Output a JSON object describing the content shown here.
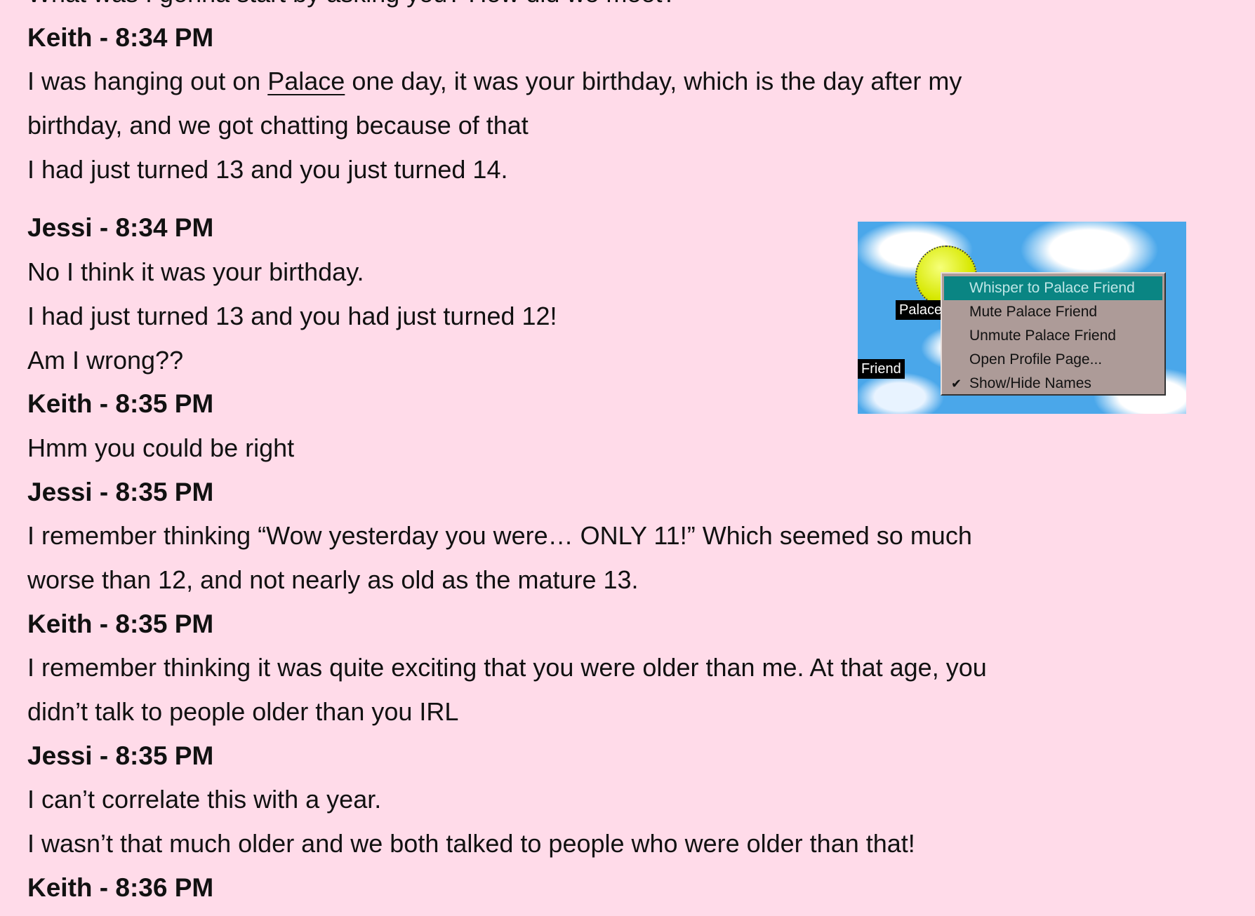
{
  "messages": [
    {
      "type": "text",
      "lines": [
        "What was I gonna start by asking you? How did we meet?"
      ]
    },
    {
      "type": "header",
      "text": "Keith - 8:34 PM"
    },
    {
      "type": "text",
      "lines": [
        "I was hanging out on ",
        "PALACE_LINK",
        " one day, it was your birthday, which is the day after my"
      ]
    }
  ],
  "link_text": "Palace",
  "line1_pre": "I was hanging out on ",
  "line1_post": " one day, it was your birthday, which is the day after my",
  "lines": [
    "What was I gonna start by asking you? How did we meet?",
    "Keith - 8:34 PM",
    "",
    "birthday, and we got chatting because of that",
    "I had just turned 13 and you just turned 14.",
    "Jessi - 8:34 PM",
    "No I think it was your birthday.",
    "I had just turned 13 and you had just turned 12!",
    "Am I wrong??",
    "Keith - 8:35 PM",
    "Hmm you could be right",
    "Jessi - 8:35 PM",
    "I remember thinking “Wow yesterday you were… ONLY 11!” Which seemed so much",
    "worse than 12, and not nearly as old as the mature 13.",
    "Keith - 8:35 PM",
    "I remember thinking it was quite exciting that you were older than me. At that age, you",
    "didn’t talk to people older than you IRL",
    "Jessi - 8:35 PM",
    "I can’t correlate this with a year.",
    "I wasn’t that much older and we both talked to people who were older than that!",
    "Keith - 8:36 PM"
  ],
  "image": {
    "name_labels": [
      "Palace",
      "Friend"
    ],
    "menu_items": [
      "Whisper to Palace Friend",
      "Mute Palace Friend",
      "Unmute Palace Friend",
      "Open Profile Page...",
      "Show/Hide Names"
    ],
    "checked_item": "Show/Hide Names",
    "highlight_color": "#0a8583"
  },
  "colors": {
    "background": "#ffdbe9",
    "text": "#111111"
  }
}
